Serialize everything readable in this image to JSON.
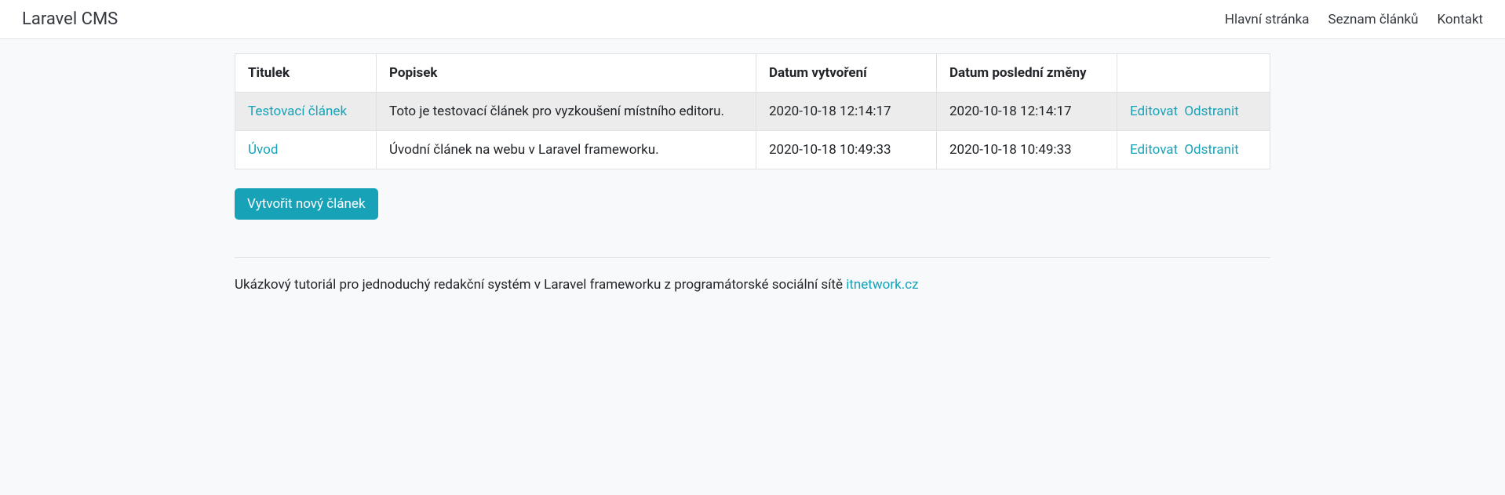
{
  "navbar": {
    "brand": "Laravel CMS",
    "links": [
      {
        "label": "Hlavní stránka"
      },
      {
        "label": "Seznam článků"
      },
      {
        "label": "Kontakt"
      }
    ]
  },
  "table": {
    "headers": {
      "title": "Titulek",
      "description": "Popisek",
      "created": "Datum vytvoření",
      "updated": "Datum poslední změny",
      "actions": ""
    },
    "rows": [
      {
        "title": "Testovací článek",
        "description": "Toto je testovací článek pro vyzkoušení místního editoru.",
        "created": "2020-10-18 12:14:17",
        "updated": "2020-10-18 12:14:17"
      },
      {
        "title": "Úvod",
        "description": "Úvodní článek na webu v Laravel frameworku.",
        "created": "2020-10-18 10:49:33",
        "updated": "2020-10-18 10:49:33"
      }
    ],
    "actions": {
      "edit": "Editovat",
      "delete": "Odstranit"
    }
  },
  "buttons": {
    "create": "Vytvořit nový článek"
  },
  "footer": {
    "text": "Ukázkový tutoriál pro jednoduchý redakční systém v Laravel frameworku z programátorské sociální sítě ",
    "link_label": "itnetwork.cz"
  }
}
